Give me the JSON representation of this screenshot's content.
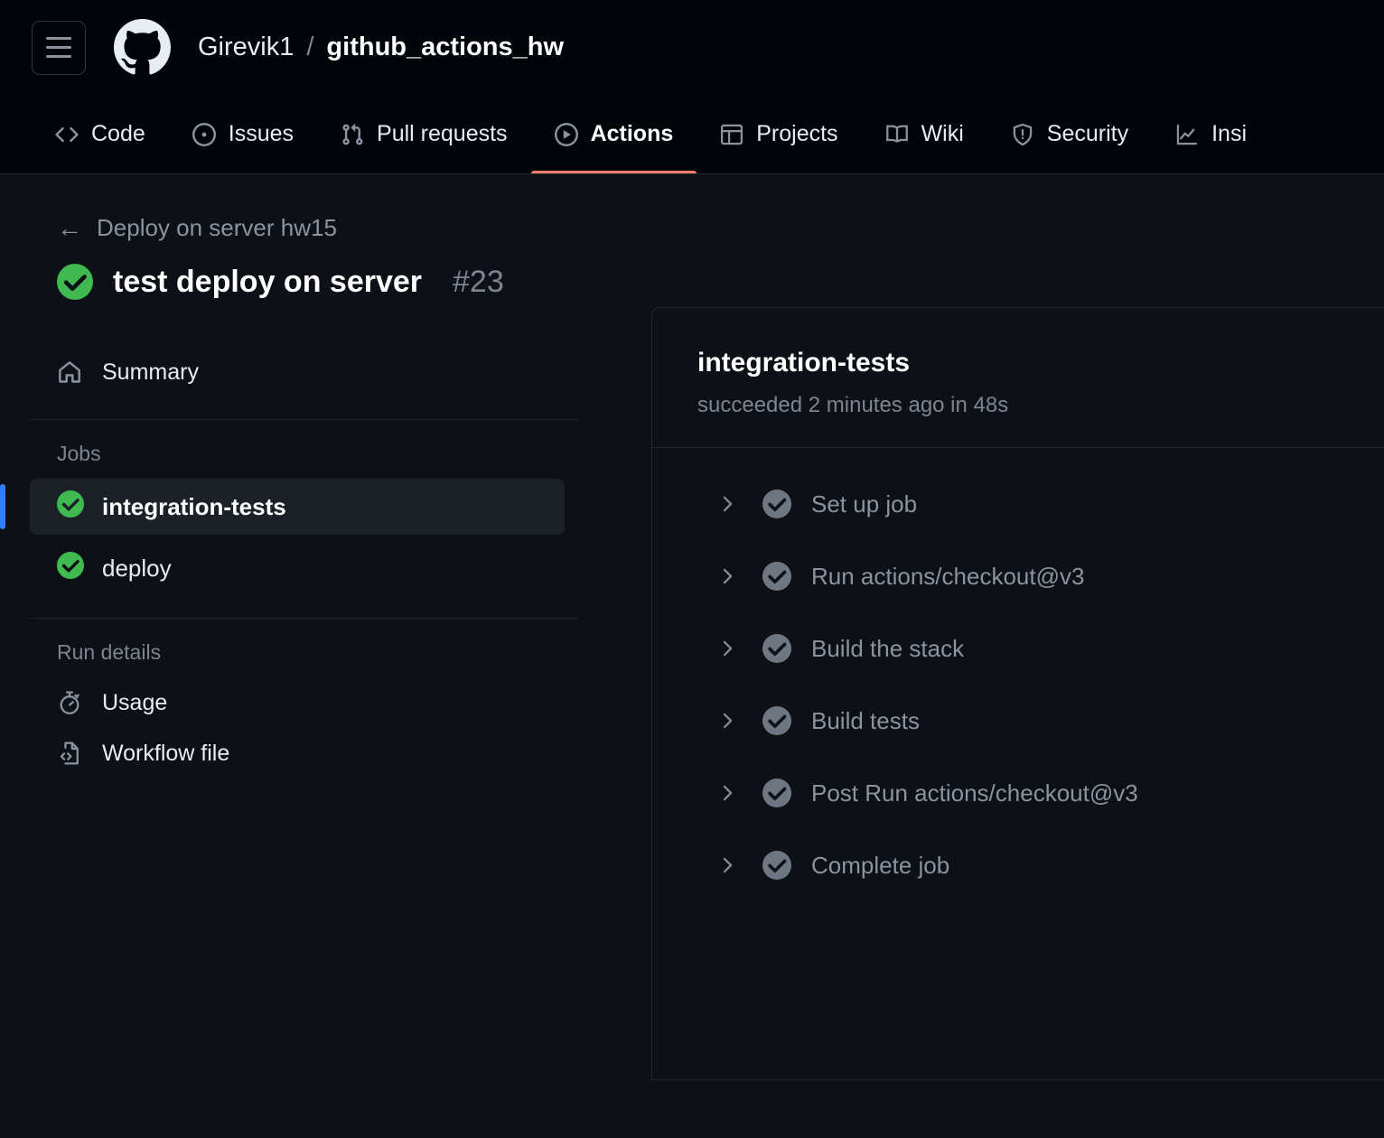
{
  "header": {
    "menu_button": "menu-icon",
    "logo": "github-logo",
    "owner": "Girevik1",
    "separator": "/",
    "repo": "github_actions_hw"
  },
  "nav": {
    "items": [
      {
        "label": "Code",
        "icon": "code-icon",
        "active": false
      },
      {
        "label": "Issues",
        "icon": "issue-opened-icon",
        "active": false
      },
      {
        "label": "Pull requests",
        "icon": "git-pull-request-icon",
        "active": false
      },
      {
        "label": "Actions",
        "icon": "play-circle-icon",
        "active": true
      },
      {
        "label": "Projects",
        "icon": "table-icon",
        "active": false
      },
      {
        "label": "Wiki",
        "icon": "book-icon",
        "active": false
      },
      {
        "label": "Security",
        "icon": "shield-icon",
        "active": false
      },
      {
        "label": "Insi",
        "icon": "graph-icon",
        "active": false
      }
    ],
    "active_color": "#f78166"
  },
  "run": {
    "back_label": "Deploy on server hw15",
    "title": "test deploy on server",
    "number": "#23",
    "status": "success",
    "status_color": "#3fb950"
  },
  "sidebar": {
    "summary": {
      "label": "Summary",
      "icon": "home-icon"
    },
    "jobs_header": "Jobs",
    "jobs": [
      {
        "label": "integration-tests",
        "status": "success",
        "selected": true
      },
      {
        "label": "deploy",
        "status": "success",
        "selected": false
      }
    ],
    "run_details_header": "Run details",
    "run_details": [
      {
        "label": "Usage",
        "icon": "stopwatch-icon"
      },
      {
        "label": "Workflow file",
        "icon": "file-code-icon"
      }
    ],
    "selected_color": "#2f81f7"
  },
  "panel": {
    "title": "integration-tests",
    "subtitle": "succeeded 2 minutes ago in 48s",
    "steps": [
      {
        "label": "Set up job",
        "status": "success"
      },
      {
        "label": "Run actions/checkout@v3",
        "status": "success"
      },
      {
        "label": "Build the stack",
        "status": "success"
      },
      {
        "label": "Build tests",
        "status": "success"
      },
      {
        "label": "Post Run actions/checkout@v3",
        "status": "success"
      },
      {
        "label": "Complete job",
        "status": "success"
      }
    ],
    "step_status_color": "#6e7681"
  }
}
